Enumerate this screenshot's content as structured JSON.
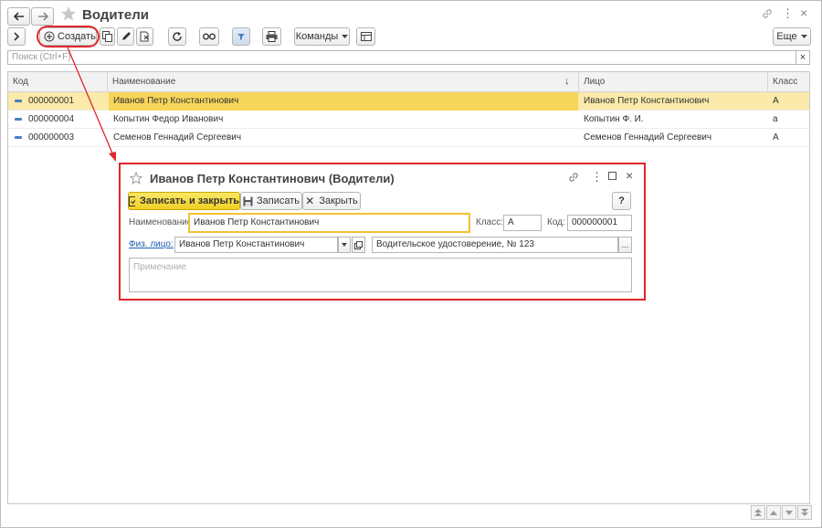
{
  "window": {
    "title": "Водители"
  },
  "toolbar": {
    "create_label": "Создать",
    "commands_label": "Команды",
    "more_label": "Еще"
  },
  "search": {
    "placeholder": "Поиск (Ctrl+F)",
    "clear": "×"
  },
  "table": {
    "columns": [
      "Код",
      "Наименование",
      "Лицо",
      "Класс"
    ],
    "sort_indicator": "↓",
    "rows": [
      {
        "code": "000000001",
        "name": "Иванов  Петр  Константинович",
        "person": "Иванов  Петр  Константинович",
        "class": "А"
      },
      {
        "code": "000000004",
        "name": "Копытин Федор Иванович",
        "person": "Копытин Ф. И.",
        "class": "а"
      },
      {
        "code": "000000003",
        "name": "Семенов Геннадий Сергеевич",
        "person": "Семенов Геннадий Сергеевич",
        "class": "А"
      }
    ]
  },
  "dialog": {
    "title": "Иванов  Петр  Константинович (Водители)",
    "save_close_label": "Записать и закрыть",
    "save_label": "Записать",
    "close_label": "Закрыть",
    "help_label": "?",
    "name_label": "Наименование:",
    "name_value": "Иванов  Петр  Константинович",
    "class_label": "Класс:",
    "class_value": "А",
    "code_label": "Код:",
    "code_value": "000000001",
    "person_label": "Физ. лицо:",
    "person_value": "Иванов  Петр  Константинович",
    "license_value": "Водительское удостоверение, № 123",
    "license_btn": "...",
    "note_placeholder": "Примечание"
  },
  "colors": {
    "highlight": "#e2262b",
    "selection": "#fbeaa9",
    "accent_yellow": "#f5dc3f",
    "link": "#1c5db3"
  }
}
